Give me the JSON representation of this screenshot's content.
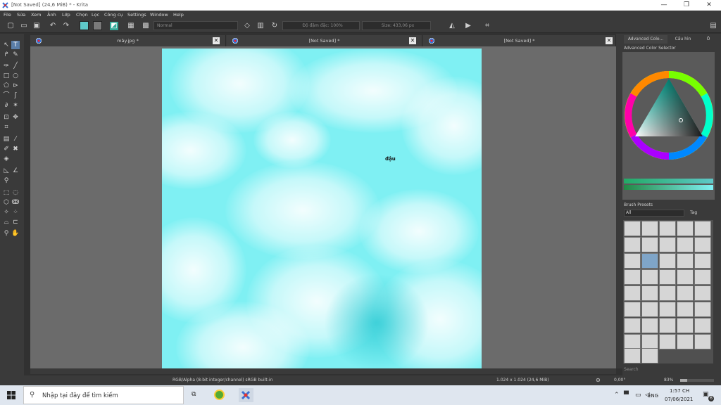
{
  "window": {
    "title": "[Not Saved]  (24,6 MiB)  * - Krita",
    "minimize": "—",
    "maximize": "❐",
    "close": "✕"
  },
  "menu": [
    "File",
    "Sửa",
    "Xem",
    "Ảnh",
    "Lớp",
    "Chọn",
    "Lọc",
    "Công cụ",
    "Settings",
    "Window",
    "Help"
  ],
  "toolbar": {
    "blend_mode": "Normal",
    "opacity": "Độ đậm đặc: 100%",
    "size": "Size: 433,06 px",
    "fg_color": "#5ec8c8",
    "bg_color": "#7a7a7a"
  },
  "tabs": [
    {
      "label": "mây.jpg *",
      "close": "✕"
    },
    {
      "label": "[Not Saved]  *",
      "close": "✕"
    },
    {
      "label": "[Not Saved]  *",
      "close": "✕"
    }
  ],
  "canvas": {
    "text": "đậu",
    "color": "#7ff0f3"
  },
  "docker": {
    "tabs": [
      "Advanced Colo...",
      "Cấu hìn",
      "Ô"
    ],
    "color_selector_title": "Advanced Color Selector",
    "brush_title": "Brush Presets",
    "brush_filter": "All",
    "brush_tag": "Tag",
    "brush_search_placeholder": "Search"
  },
  "status": {
    "color_profile": "RGB/Alpha (8-bit integer/channel)  sRGB built-in",
    "image_size": "1.024 x 1.024 (24,6 MiB)",
    "rotation": "0,00°",
    "zoom": "83%"
  },
  "taskbar": {
    "search_placeholder": "Nhập tại đây để tìm kiếm",
    "language": "ENG",
    "time": "1:57 CH",
    "date": "07/06/2021",
    "notification_count": "6"
  }
}
